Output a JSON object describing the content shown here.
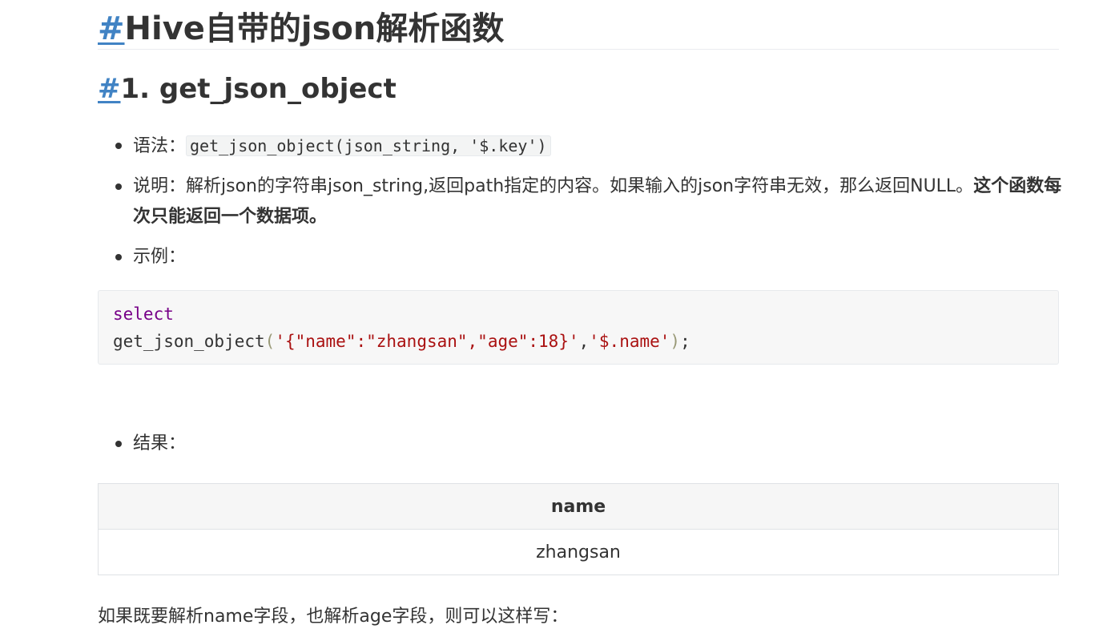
{
  "h1": {
    "anchor": "#",
    "text": "Hive自带的json解析函数"
  },
  "h2": {
    "anchor": "#",
    "text": "1. get_json_object"
  },
  "list1": {
    "syntax_label": "语法：",
    "syntax_code": "get_json_object(json_string, '$.key')",
    "desc_label": "说明：",
    "desc_text": "解析json的字符串json_string,返回path指定的内容。如果输入的json字符串无效，那么返回NULL。",
    "desc_bold": "这个函数每次只能返回一个数据项。",
    "example_label": "示例："
  },
  "code": {
    "keyword": "select",
    "func": "get_json_object",
    "open_paren": "(",
    "arg1": "'{\"name\":\"zhangsan\",\"age\":18}'",
    "comma": ",",
    "arg2": "'$.name'",
    "close_paren": ")",
    "semicolon": ";"
  },
  "result_label": "结果：",
  "table": {
    "header": "name",
    "rows": [
      "zhangsan"
    ]
  },
  "paragraph": "如果既要解析name字段，也解析age字段，则可以这样写："
}
